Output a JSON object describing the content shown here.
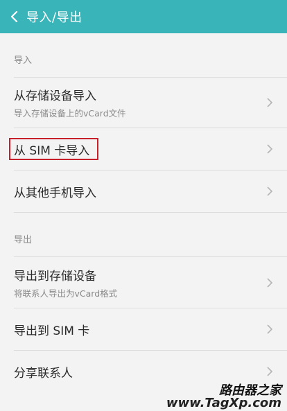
{
  "header": {
    "title": "导入/导出",
    "back_icon": "chevron-left-icon",
    "background": "#39b4b8"
  },
  "sections": {
    "import_label": "导入",
    "export_label": "导出"
  },
  "items": {
    "import_storage": {
      "title": "从存储设备导入",
      "subtitle": "导入存储设备上的vCard文件"
    },
    "import_sim": {
      "title": "从 SIM 卡导入"
    },
    "import_other_phone": {
      "title": "从其他手机导入"
    },
    "export_storage": {
      "title": "导出到存储设备",
      "subtitle": "将联系人导出为vCard格式"
    },
    "export_sim": {
      "title": "导出到 SIM 卡"
    },
    "share_contacts": {
      "title": "分享联系人"
    }
  },
  "watermark": {
    "cn": "路由器之家",
    "en": "www.TagXp.com"
  },
  "highlight_color": "#c8202a"
}
